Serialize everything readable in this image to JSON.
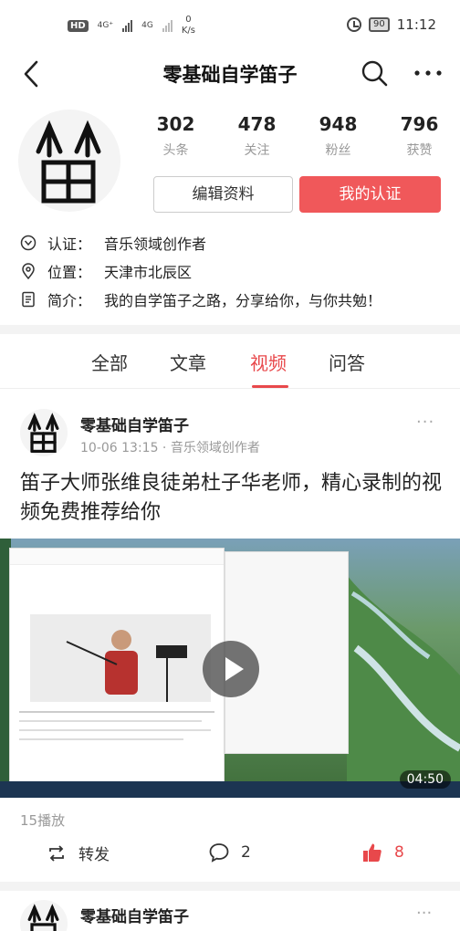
{
  "status_bar": {
    "hd": "HD",
    "net1": "4G⁺",
    "net2": "4G",
    "speed_value": "0",
    "speed_unit": "K/s",
    "battery": "90",
    "time": "11:12"
  },
  "nav": {
    "title": "零基础自学笛子"
  },
  "profile": {
    "stats": [
      {
        "num": "302",
        "label": "头条"
      },
      {
        "num": "478",
        "label": "关注"
      },
      {
        "num": "948",
        "label": "粉丝"
      },
      {
        "num": "796",
        "label": "获赞"
      }
    ],
    "edit_label": "编辑资料",
    "cert_label": "我的认证",
    "cert_row": {
      "label": "认证：",
      "value": "音乐领域创作者"
    },
    "location_row": {
      "label": "位置：",
      "value": "天津市北辰区"
    },
    "intro_row": {
      "label": "简介：",
      "value": "我的自学笛子之路，分享给你，与你共勉！"
    }
  },
  "tabs": [
    {
      "label": "全部"
    },
    {
      "label": "文章"
    },
    {
      "label": "视频"
    },
    {
      "label": "问答"
    }
  ],
  "post": {
    "author": "零基础自学笛子",
    "meta": "10-06 13:15 · 音乐领域创作者",
    "more": "···",
    "title": "笛子大师张维良徒弟杜子华老师，精心录制的视频免费推荐给你",
    "duration": "04:50",
    "plays": "15播放",
    "repost_label": "转发",
    "comment_count": "2",
    "like_count": "8"
  },
  "post2": {
    "author": "零基础自学笛子",
    "more": "···"
  },
  "colors": {
    "accent": "#e8484b",
    "cert_button": "#f0585a"
  }
}
